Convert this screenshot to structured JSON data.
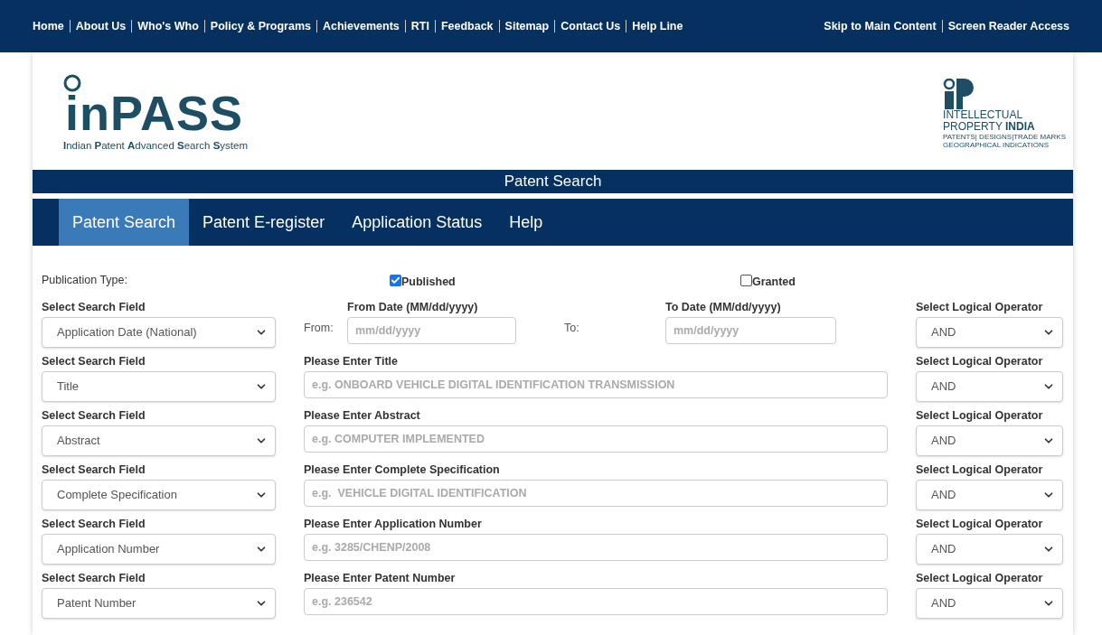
{
  "top_links": [
    "Home",
    "About Us",
    "Who's Who",
    "Policy & Programs",
    "Achievements",
    "RTI",
    "Feedback",
    "Sitemap",
    "Contact Us",
    "Help Line"
  ],
  "access_links": [
    "Skip to Main Content",
    "Screen Reader Access"
  ],
  "logo": {
    "wordmark": "inPASS",
    "subtitle": "**I**ndian **P**atent **A**dvanced **S**earch **S**ystem"
  },
  "ip_logo": {
    "lines": [
      "INTELLECTUAL",
      "PROPERTY **INDIA**",
      "PATENTS| DESIGNS|TRADE MARKS",
      "GEOGRAPHICAL INDICATIONS"
    ]
  },
  "title_bar": "Patent Search",
  "tabs": [
    {
      "label": "Patent Search",
      "selected": true
    },
    {
      "label": "Patent E-register",
      "selected": false
    },
    {
      "label": "Application Status",
      "selected": false
    },
    {
      "label": "Help",
      "selected": false
    }
  ],
  "publication_type": {
    "label": "Publication Type:",
    "options": [
      {
        "label": "Published",
        "checked": true
      },
      {
        "label": "Granted",
        "checked": false
      }
    ]
  },
  "rows": [
    {
      "kind": "date",
      "field_label": "Select Search Field",
      "field_value": "Application Date (National)",
      "from_prefix": "From:",
      "from_label": "From Date (MM/dd/yyyy)",
      "from_placeholder": "mm/dd/yyyy",
      "to_prefix": "To:",
      "to_label": "To Date (MM/dd/yyyy)",
      "to_placeholder": "mm/dd/yyyy",
      "operator_label": "Select Logical Operator",
      "operator": "AND"
    },
    {
      "kind": "text",
      "field_label": "Select Search Field",
      "field_value": "Title",
      "input_label": "Please Enter Title",
      "placeholder": "e.g. ONBOARD VEHICLE DIGITAL IDENTIFICATION TRANSMISSION",
      "operator_label": "Select Logical Operator",
      "operator": "AND"
    },
    {
      "kind": "text",
      "field_label": "Select Search Field",
      "field_value": "Abstract",
      "input_label": "Please Enter Abstract",
      "placeholder": "e.g. COMPUTER IMPLEMENTED",
      "operator_label": "Select Logical Operator",
      "operator": "AND"
    },
    {
      "kind": "text",
      "field_label": "Select Search Field",
      "field_value": "Complete Specification",
      "input_label": "Please Enter Complete Specification",
      "placeholder": "e.g.  VEHICLE DIGITAL IDENTIFICATION",
      "operator_label": "Select Logical Operator",
      "operator": "AND"
    },
    {
      "kind": "text",
      "field_label": "Select Search Field",
      "field_value": "Application Number",
      "input_label": "Please Enter Application Number",
      "placeholder": "e.g. 3285/CHENP/2008",
      "operator_label": "Select Logical Operator",
      "operator": "AND"
    },
    {
      "kind": "text",
      "field_label": "Select Search Field",
      "field_value": "Patent Number",
      "input_label": "Please Enter Patent Number",
      "placeholder": "e.g. 236542",
      "operator_label": "Select Logical Operator",
      "operator": "AND"
    }
  ]
}
